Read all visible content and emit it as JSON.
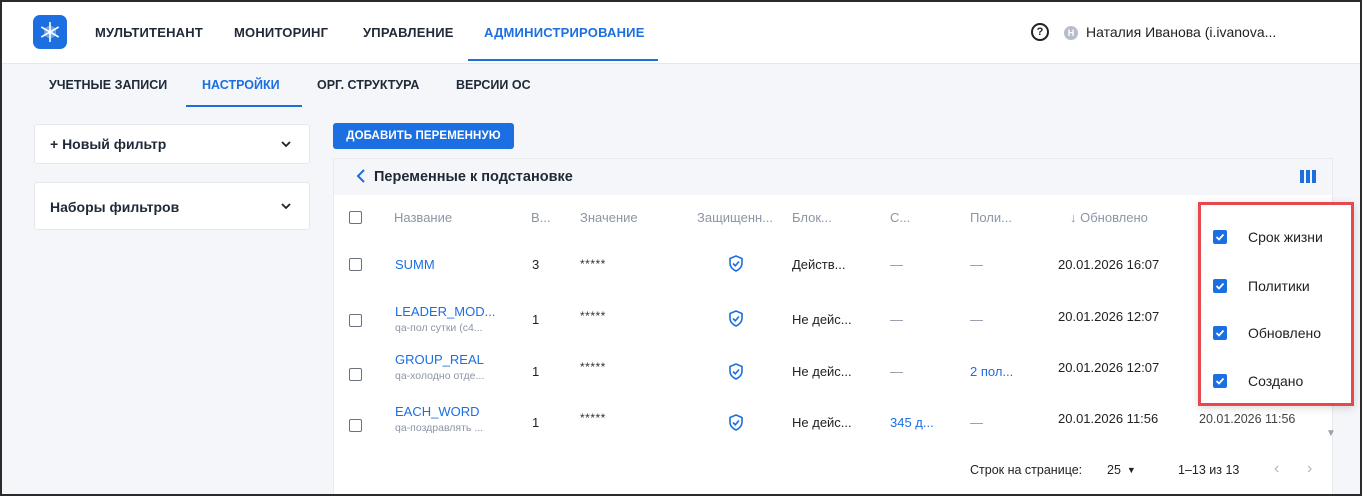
{
  "topnav": {
    "items": [
      "МУЛЬТИТЕНАНТ",
      "МОНИТОРИНГ",
      "УПРАВЛЕНИЕ",
      "АДМИНИСТРИРОВАНИЕ"
    ],
    "active": "АДМИНИСТРИРОВАНИЕ"
  },
  "user": {
    "avatar_letter": "Н",
    "name": "Наталия Иванова (i.ivanova..."
  },
  "subtabs": {
    "items": [
      "УЧЕТНЫЕ ЗАПИСИ",
      "НАСТРОЙКИ",
      "ОРГ. СТРУКТУРА",
      "ВЕРСИИ ОС"
    ],
    "active": "НАСТРОЙКИ"
  },
  "filters": {
    "new_filter": "+ Новый фильтр",
    "filter_sets": "Наборы фильтров"
  },
  "add_button": "ДОБАВИТЬ ПЕРЕМЕННУЮ",
  "table": {
    "title": "Переменные к подстановке",
    "headers": {
      "name": "Название",
      "version": "В...",
      "value": "Значение",
      "protected": "Защищенн...",
      "block": "Блок...",
      "c": "С...",
      "policies": "Поли...",
      "updated": "↓ Обновлено"
    },
    "rows": [
      {
        "name": "SUMM",
        "desc": "",
        "version": "3",
        "value": "*****",
        "block": "Действ...",
        "c": "—",
        "policies": "—",
        "updated": "20.01.2026 16:07"
      },
      {
        "name": "LEADER_MOD...",
        "desc": "qa-пол сутки (c4...",
        "version": "1",
        "value": "*****",
        "block": "Не дейс...",
        "c": "—",
        "policies": "—",
        "updated": "20.01.2026 12:07"
      },
      {
        "name": "GROUP_REAL",
        "desc": "qa-холодно отде...",
        "version": "1",
        "value": "*****",
        "block": "Не дейс...",
        "c": "—",
        "policies": "2 пол...",
        "updated": "20.01.2026 12:07"
      },
      {
        "name": "EACH_WORD",
        "desc": "qa-поздравлять ...",
        "version": "1",
        "value": "*****",
        "block": "Не дейс...",
        "c": "345 д...",
        "policies": "—",
        "updated": "20.01.2026 11:56"
      }
    ],
    "hidden_created_value": "20.01.2026 11:56"
  },
  "pagination": {
    "rows_label": "Строк на странице:",
    "rows_value": "25",
    "range": "1–13 из 13"
  },
  "column_menu": {
    "items": [
      "Срок жизни",
      "Политики",
      "Обновлено",
      "Создано"
    ]
  },
  "colors": {
    "accent": "#1b6fe0",
    "highlight": "#e5484d"
  }
}
